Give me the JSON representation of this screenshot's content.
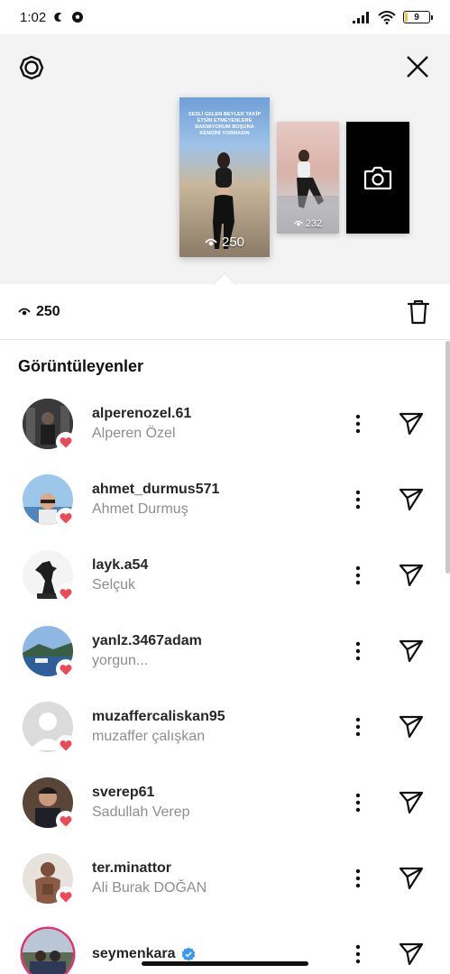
{
  "status_bar": {
    "time": "1:02",
    "battery": "9",
    "icons": [
      "moon-c-icon",
      "soccer-ball-icon",
      "signal-icon",
      "wifi-icon",
      "battery-icon"
    ]
  },
  "header": {
    "settings_icon": "gear-icon",
    "close_icon": "close-icon"
  },
  "stories": [
    {
      "caption": "SESLİ GELEN BEYLER TAKİP ETSİN ETMEYENLERE BAKMIYORUM BOŞUNA KENDİNİ YORMASIN",
      "views": "250",
      "selected": true
    },
    {
      "views": "232",
      "selected": false
    },
    {
      "type": "add-story",
      "icon": "camera-icon"
    }
  ],
  "summary": {
    "views": "250",
    "delete_icon": "trash-icon"
  },
  "section_title": "Görüntüleyenler",
  "viewers": [
    {
      "username": "alperenozel.61",
      "fullname": "Alperen Özel",
      "liked": true,
      "verified": false,
      "avatar_color": "#3a3a3a"
    },
    {
      "username": "ahmet_durmus571",
      "fullname": "Ahmet Durmuş",
      "liked": true,
      "verified": false,
      "avatar_color": "#8fb9e0"
    },
    {
      "username": "layk.a54",
      "fullname": "Selçuk",
      "liked": true,
      "verified": false,
      "avatar_color": "#f2f2f2"
    },
    {
      "username": "yanlz.3467adam",
      "fullname": "yorgun...",
      "liked": true,
      "verified": false,
      "avatar_color": "#4a79b5"
    },
    {
      "username": "muzaffercaliskan95",
      "fullname": "muzaffer çalışkan",
      "liked": true,
      "verified": false,
      "avatar_color": "#dbdbdb"
    },
    {
      "username": "sverep61",
      "fullname": "Sadullah Verep",
      "liked": true,
      "verified": false,
      "avatar_color": "#4a3a2e"
    },
    {
      "username": "ter.minattor",
      "fullname": "Ali Burak DOĞAN",
      "liked": true,
      "verified": false,
      "avatar_color": "#6b4a3a"
    },
    {
      "username": "seymenkara",
      "fullname": "",
      "liked": false,
      "verified": true,
      "avatar_color": "#7a8aa0"
    }
  ],
  "colors": {
    "heart": "#ed4956",
    "verified": "#3897f0",
    "story_ring": "#e1306c",
    "secondary_text": "#8e8e8e"
  }
}
